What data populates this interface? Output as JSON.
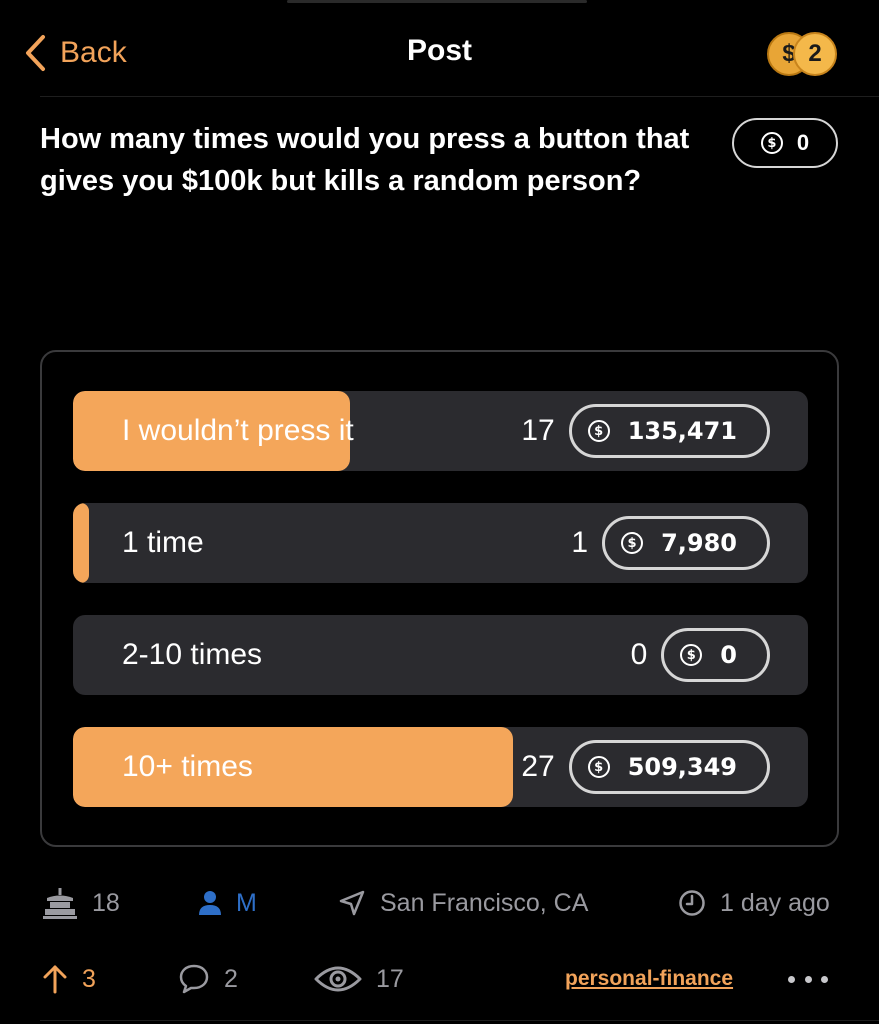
{
  "header": {
    "back_label": "Back",
    "title": "Post",
    "coins_count": "2"
  },
  "post": {
    "question": "How many times would you press a button that gives you $100k but kills a random person?",
    "bounty": "0"
  },
  "poll": {
    "options": [
      {
        "label": "I wouldn’t press it",
        "votes": "17",
        "tips": "135,471",
        "fill_fraction": 0.377
      },
      {
        "label": "1 time",
        "votes": "1",
        "tips": "7,980",
        "fill_fraction": 0.022
      },
      {
        "label": "2-10 times",
        "votes": "0",
        "tips": "0",
        "fill_fraction": 0
      },
      {
        "label": "10+ times",
        "votes": "27",
        "tips": "509,349",
        "fill_fraction": 0.599
      }
    ]
  },
  "meta": {
    "level": "18",
    "author": "M",
    "location": "San Francisco, CA",
    "time": "1 day ago"
  },
  "actions": {
    "upvotes": "3",
    "comments": "2",
    "views": "17",
    "tag": "personal-finance"
  },
  "colors": {
    "accent": "#F2A35A",
    "poll_fill": "#F4A65A",
    "poll_track": "#2b2b2f",
    "author": "#2E6FC8",
    "muted": "#9a9aa0",
    "background": "#000000"
  },
  "icons": {
    "back": "chevron-left-icon",
    "coins": "coins-icon",
    "currency": "dollar-circle-icon",
    "level": "cake-icon",
    "author": "person-icon",
    "location": "location-arrow-icon",
    "time": "clock-icon",
    "upvote": "arrow-up-icon",
    "comments": "speech-bubble-icon",
    "views": "eye-icon",
    "more": "ellipsis-icon"
  }
}
